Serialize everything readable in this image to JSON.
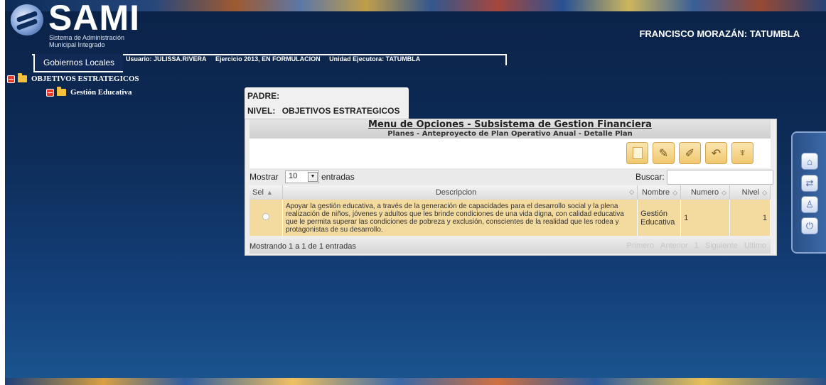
{
  "app": {
    "logo_text": "SAMI",
    "logo_subtitle_1": "Sistema de Administración",
    "logo_subtitle_2": "Municipal Integrado",
    "municipality": "FRANCISCO MORAZÁN: TATUMBLA"
  },
  "tabbar": {
    "tab_label": "Gobiernos Locales",
    "user": "Usuario: JULISSA.RIVERA",
    "exercise": "Ejercicio 2013, EN FORMULACION",
    "unit": "Unidad Ejecutora: TATUMBLA"
  },
  "tree": {
    "root": "OBJETIVOS ESTRATEGICOS",
    "child": "Gestión Educativa"
  },
  "context": {
    "padre_label": "PADRE:",
    "nivel_label": "NIVEL:",
    "nivel_value": "OBJETIVOS ESTRATEGICOS"
  },
  "panel": {
    "title": "Menu de Opciones - Subsistema de Gestion Financiera",
    "subtitle": "Planes - Anteproyecto de Plan Operativo Anual - Detalle Plan",
    "toolbar_icons": [
      "new-icon",
      "edit-icon",
      "delete-icon",
      "undo-icon",
      "reports-icon"
    ]
  },
  "controls": {
    "show_label": "Mostrar",
    "show_value": "10",
    "entries_label": "entradas",
    "search_label": "Buscar:",
    "search_value": ""
  },
  "table": {
    "headers": [
      "Sel",
      "Descripcion",
      "Nombre",
      "Numero",
      "Nivel"
    ],
    "rows": [
      {
        "descripcion": "Apoyar la gestión educativa, a través de la generación de capacidades para el desarrollo social y la plena realización de niños, jóvenes y adultos que les brinde condiciones de una vida digna, con calidad educativa que le permita superar las condiciones de pobreza y exclusión, conscientes de la realidad que les rodea y protagonistas de su desarrollo.",
        "nombre": "Gestión Educativa",
        "numero": "1",
        "nivel": "1"
      }
    ]
  },
  "footer": {
    "info": "Mostrando 1 a 1 de 1 entradas",
    "first": "Primero",
    "previous": "Anterior",
    "page": "1",
    "next": "Siguiente",
    "last": "Ultimo"
  },
  "dock": [
    "home-icon",
    "switch-system-icon",
    "user-icon",
    "power-icon"
  ],
  "colors": {
    "background": "#0d2c58",
    "row_highlight": "#f3dba0",
    "toolbar_button": "#f0c870"
  }
}
